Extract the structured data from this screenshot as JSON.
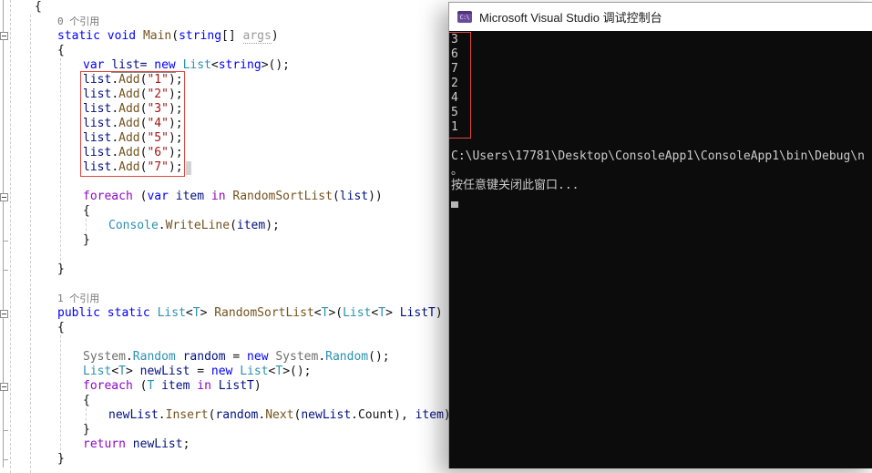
{
  "colors": {
    "annotation_red": "#e04640",
    "console_background": "#0c0c0c",
    "console_text": "#cccccc",
    "titlebar_background": "#ffffff",
    "console_icon_purple": "#6b4a9e",
    "keyword_blue": "#0000ff",
    "control_keyword_purple": "#8f08c4",
    "type_teal": "#2b91af",
    "method_brown": "#74531f",
    "string_red": "#a31515",
    "local_navy": "#001080"
  },
  "editor": {
    "codelens_main": "0 个引用",
    "codelens_random": "1 个引用",
    "lines": [
      {
        "ind": 38,
        "t": [
          [
            "p",
            "{"
          ]
        ]
      },
      {
        "ind": 63,
        "t": [
          [
            "g",
            "0 个引用"
          ]
        ]
      },
      {
        "ind": 63,
        "t": [
          [
            "k",
            "static"
          ],
          [
            "p",
            " "
          ],
          [
            "k",
            "void"
          ],
          [
            "p",
            " "
          ],
          [
            "m",
            "Main"
          ],
          [
            "p",
            "("
          ],
          [
            "k",
            "string"
          ],
          [
            "p",
            "[] "
          ],
          [
            "d",
            "args"
          ],
          [
            "p",
            ")"
          ]
        ]
      },
      {
        "ind": 63,
        "t": [
          [
            "p",
            "{"
          ]
        ]
      },
      {
        "ind": 91,
        "t": [
          [
            "k",
            "var"
          ],
          [
            "p",
            " "
          ],
          [
            "vu",
            "list="
          ],
          [
            "ku",
            " new"
          ],
          [
            "p",
            " "
          ],
          [
            "t",
            "List"
          ],
          [
            "p",
            "<"
          ],
          [
            "k",
            "string"
          ],
          [
            "p",
            ">();"
          ]
        ]
      },
      {
        "ind": 91,
        "t": [
          [
            "v",
            "list"
          ],
          [
            "p",
            "."
          ],
          [
            "m",
            "Add"
          ],
          [
            "p",
            "("
          ],
          [
            "s",
            "\"1\""
          ],
          [
            "p",
            ");"
          ]
        ]
      },
      {
        "ind": 91,
        "t": [
          [
            "v",
            "list"
          ],
          [
            "p",
            "."
          ],
          [
            "m",
            "Add"
          ],
          [
            "p",
            "("
          ],
          [
            "s",
            "\"2\""
          ],
          [
            "p",
            ");"
          ]
        ]
      },
      {
        "ind": 91,
        "t": [
          [
            "v",
            "list"
          ],
          [
            "p",
            "."
          ],
          [
            "m",
            "Add"
          ],
          [
            "p",
            "("
          ],
          [
            "s",
            "\"3\""
          ],
          [
            "p",
            ");"
          ]
        ]
      },
      {
        "ind": 91,
        "t": [
          [
            "v",
            "list"
          ],
          [
            "p",
            "."
          ],
          [
            "m",
            "Add"
          ],
          [
            "p",
            "("
          ],
          [
            "s",
            "\"4\""
          ],
          [
            "p",
            ");"
          ]
        ]
      },
      {
        "ind": 91,
        "t": [
          [
            "v",
            "list"
          ],
          [
            "p",
            "."
          ],
          [
            "m",
            "Add"
          ],
          [
            "p",
            "("
          ],
          [
            "s",
            "\"5\""
          ],
          [
            "p",
            ");"
          ]
        ]
      },
      {
        "ind": 91,
        "t": [
          [
            "v",
            "list"
          ],
          [
            "p",
            "."
          ],
          [
            "m",
            "Add"
          ],
          [
            "p",
            "("
          ],
          [
            "s",
            "\"6\""
          ],
          [
            "p",
            ");"
          ]
        ]
      },
      {
        "ind": 91,
        "t": [
          [
            "v",
            "list"
          ],
          [
            "p",
            "."
          ],
          [
            "m",
            "Add"
          ],
          [
            "p",
            "("
          ],
          [
            "s",
            "\"7\""
          ],
          [
            "p",
            ");"
          ]
        ]
      },
      {
        "ind": 0,
        "t": []
      },
      {
        "ind": 91,
        "t": [
          [
            "c",
            "foreach"
          ],
          [
            "p",
            " ("
          ],
          [
            "k",
            "var"
          ],
          [
            "p",
            " "
          ],
          [
            "v",
            "item"
          ],
          [
            "p",
            " "
          ],
          [
            "c",
            "in"
          ],
          [
            "p",
            " "
          ],
          [
            "m",
            "RandomSortList"
          ],
          [
            "p",
            "("
          ],
          [
            "v",
            "list"
          ],
          [
            "p",
            "))"
          ]
        ]
      },
      {
        "ind": 91,
        "t": [
          [
            "p",
            "{"
          ]
        ]
      },
      {
        "ind": 119,
        "t": [
          [
            "t",
            "Console"
          ],
          [
            "p",
            "."
          ],
          [
            "m",
            "WriteLine"
          ],
          [
            "p",
            "("
          ],
          [
            "v",
            "item"
          ],
          [
            "p",
            ");"
          ]
        ]
      },
      {
        "ind": 91,
        "t": [
          [
            "p",
            "}"
          ]
        ]
      },
      {
        "ind": 0,
        "t": []
      },
      {
        "ind": 63,
        "t": [
          [
            "p",
            "}"
          ]
        ]
      },
      {
        "ind": 0,
        "t": []
      },
      {
        "ind": 63,
        "t": [
          [
            "g",
            "1 个引用"
          ]
        ]
      },
      {
        "ind": 63,
        "t": [
          [
            "k",
            "public"
          ],
          [
            "p",
            " "
          ],
          [
            "k",
            "static"
          ],
          [
            "p",
            " "
          ],
          [
            "t",
            "List"
          ],
          [
            "p",
            "<"
          ],
          [
            "t",
            "T"
          ],
          [
            "p",
            "> "
          ],
          [
            "m",
            "RandomSortList"
          ],
          [
            "p",
            "<"
          ],
          [
            "t",
            "T"
          ],
          [
            "p",
            ">("
          ],
          [
            "t",
            "List"
          ],
          [
            "p",
            "<"
          ],
          [
            "t",
            "T"
          ],
          [
            "p",
            "> "
          ],
          [
            "v",
            "ListT"
          ],
          [
            "p",
            ")"
          ]
        ]
      },
      {
        "ind": 63,
        "t": [
          [
            "p",
            "{"
          ]
        ]
      },
      {
        "ind": 0,
        "t": []
      },
      {
        "ind": 91,
        "t": [
          [
            "n",
            "System"
          ],
          [
            "p",
            "."
          ],
          [
            "t",
            "Random"
          ],
          [
            "p",
            " "
          ],
          [
            "v",
            "random"
          ],
          [
            "p",
            " = "
          ],
          [
            "k",
            "new"
          ],
          [
            "p",
            " "
          ],
          [
            "n",
            "System"
          ],
          [
            "p",
            "."
          ],
          [
            "t",
            "Random"
          ],
          [
            "p",
            "();"
          ]
        ]
      },
      {
        "ind": 91,
        "t": [
          [
            "t",
            "List"
          ],
          [
            "p",
            "<"
          ],
          [
            "t",
            "T"
          ],
          [
            "p",
            "> "
          ],
          [
            "v",
            "newList"
          ],
          [
            "p",
            " = "
          ],
          [
            "k",
            "new"
          ],
          [
            "p",
            " "
          ],
          [
            "t",
            "List"
          ],
          [
            "p",
            "<"
          ],
          [
            "t",
            "T"
          ],
          [
            "p",
            ">();"
          ]
        ]
      },
      {
        "ind": 91,
        "t": [
          [
            "c",
            "foreach"
          ],
          [
            "p",
            " ("
          ],
          [
            "t",
            "T"
          ],
          [
            "p",
            " "
          ],
          [
            "v",
            "item"
          ],
          [
            "p",
            " "
          ],
          [
            "c",
            "in"
          ],
          [
            "p",
            " "
          ],
          [
            "v",
            "ListT"
          ],
          [
            "p",
            ")"
          ]
        ]
      },
      {
        "ind": 91,
        "t": [
          [
            "p",
            "{"
          ]
        ]
      },
      {
        "ind": 119,
        "t": [
          [
            "v",
            "newList"
          ],
          [
            "p",
            "."
          ],
          [
            "m",
            "Insert"
          ],
          [
            "p",
            "("
          ],
          [
            "v",
            "random"
          ],
          [
            "p",
            "."
          ],
          [
            "m",
            "Next"
          ],
          [
            "p",
            "("
          ],
          [
            "v",
            "newList"
          ],
          [
            "p",
            "."
          ],
          [
            "p",
            "Count"
          ],
          [
            "p",
            "), "
          ],
          [
            "v",
            "item"
          ],
          [
            "p",
            ");"
          ]
        ]
      },
      {
        "ind": 91,
        "t": [
          [
            "p",
            "}"
          ]
        ]
      },
      {
        "ind": 91,
        "t": [
          [
            "c",
            "return"
          ],
          [
            "p",
            " "
          ],
          [
            "v",
            "newList"
          ],
          [
            "p",
            ";"
          ]
        ]
      },
      {
        "ind": 63,
        "t": [
          [
            "p",
            "}"
          ]
        ]
      }
    ]
  },
  "console": {
    "title": "Microsoft Visual Studio 调试控制台",
    "icon_label": "C:\\",
    "output": [
      "3",
      "6",
      "7",
      "2",
      "4",
      "5",
      "1"
    ],
    "path_line": "C:\\Users\\17781\\Desktop\\ConsoleApp1\\ConsoleApp1\\bin\\Debug\\n",
    "wrap_line": "。",
    "prompt_line": "按任意键关闭此窗口..."
  }
}
